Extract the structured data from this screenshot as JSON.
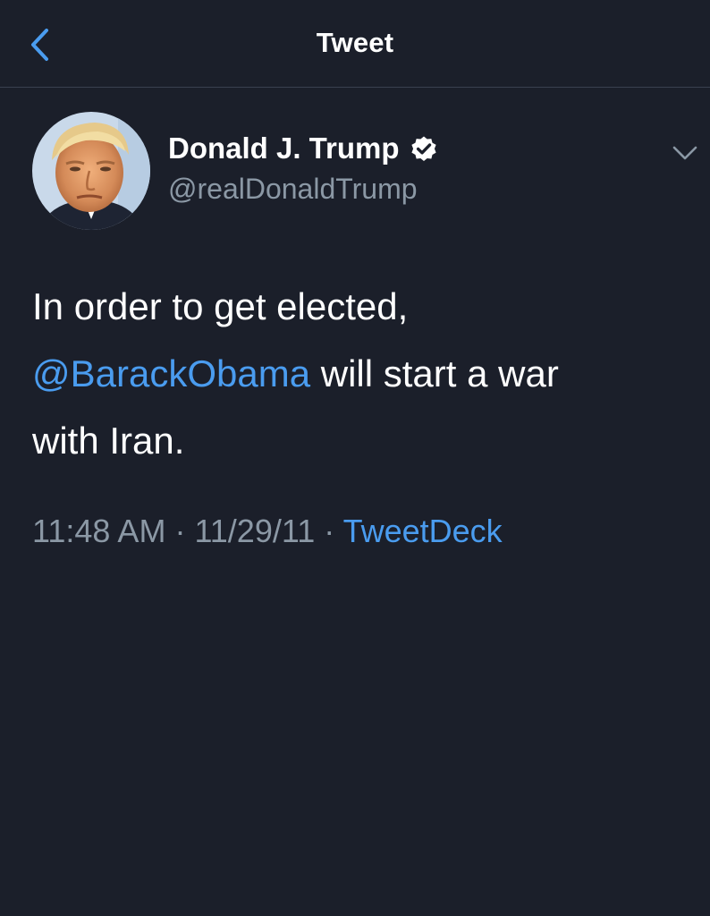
{
  "nav": {
    "title": "Tweet",
    "back_icon": "chevron-left-icon",
    "accent_color": "#4a9cef"
  },
  "tweet": {
    "author": {
      "display_name": "Donald J. Trump",
      "handle": "@realDonaldTrump",
      "verified": true,
      "verified_icon": "verified-badge-icon"
    },
    "more_icon": "chevron-down-icon",
    "text": {
      "line1": "In order to get elected,",
      "mention": "@BarackObama",
      "after_mention": " will start a war",
      "line3": "with Iran."
    },
    "meta": {
      "time": "11:48 AM",
      "separator": " · ",
      "date": "11/29/11",
      "source": "TweetDeck"
    }
  },
  "colors": {
    "background": "#1b1f2a",
    "primary_text": "#ffffff",
    "secondary_text": "#8b98a5",
    "link": "#4a9cef",
    "divider": "#3a4150"
  }
}
